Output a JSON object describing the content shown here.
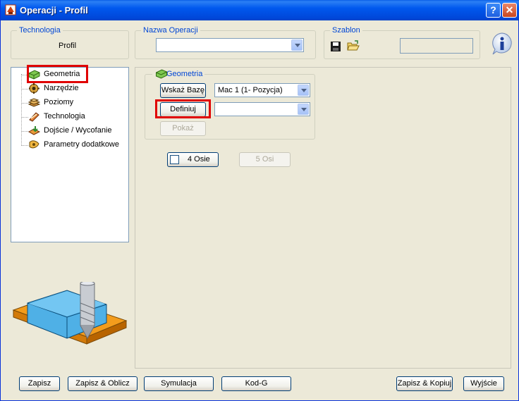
{
  "window": {
    "title": "Operacji - Profil",
    "help_glyph": "?",
    "close_glyph": "✕"
  },
  "technologia": {
    "label": "Technologia",
    "value": "Profil"
  },
  "nazwa": {
    "label": "Nazwa Operacji",
    "value": ""
  },
  "szablon": {
    "label": "Szablon",
    "value": ""
  },
  "tree": {
    "items": [
      {
        "label": "Geometria",
        "icon": "geometry-icon"
      },
      {
        "label": "Narzędzie",
        "icon": "tool-icon"
      },
      {
        "label": "Poziomy",
        "icon": "levels-icon"
      },
      {
        "label": "Technologia",
        "icon": "technology-icon"
      },
      {
        "label": "Dojście / Wycofanie",
        "icon": "approach-retract-icon"
      },
      {
        "label": "Parametry dodatkowe",
        "icon": "additional-params-icon"
      }
    ]
  },
  "geometria_group": {
    "label": "Geometria",
    "wskaz_baze": "Wskaż Bazę",
    "base_value": "Mac 1 (1- Pozycja)",
    "definiuj": "Definiuj",
    "define_value": "",
    "pokaz": "Pokaż"
  },
  "axes": {
    "four": "4 Osie",
    "five": "5 Osi"
  },
  "bottom": {
    "zapisz": "Zapisz",
    "zapisz_oblicz": "Zapisz & Oblicz",
    "symulacja": "Symulacja",
    "kod_g": "Kod-G",
    "zapisz_kopiuj": "Zapisz & Kopiuj",
    "wyjscie": "Wyjście"
  },
  "colors": {
    "title_bar": "#0054e3",
    "highlight": "#e00000",
    "group_label": "#0046d5"
  }
}
